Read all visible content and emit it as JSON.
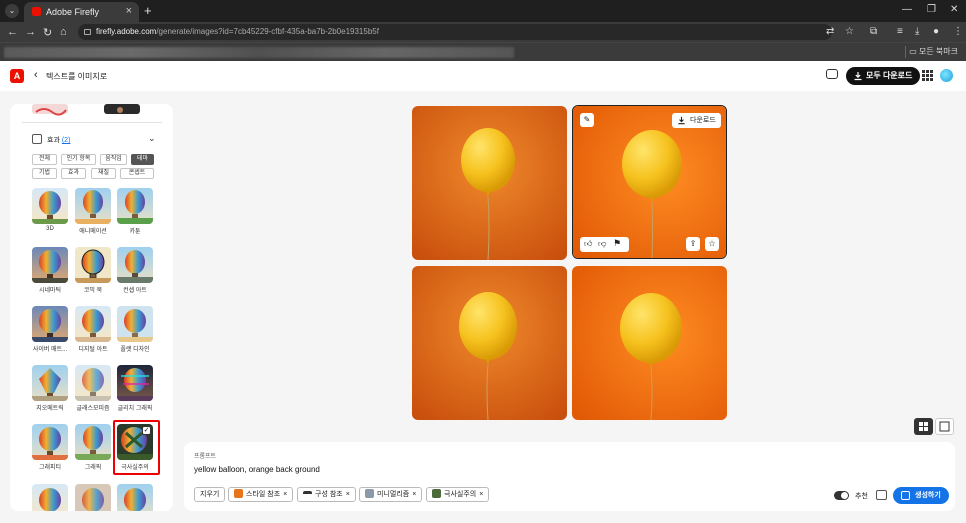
{
  "browser": {
    "tab_title": "Adobe Firefly",
    "url_host": "firefly.adobe.com",
    "url_path": "/generate/images?id=7cb45229-cfbf-435a-ba7b-2b0e19315b5f",
    "bookmarks_all": "모든 북마크"
  },
  "app": {
    "logo_text": "A",
    "breadcrumb": "텍스트를 이미지로",
    "download_all_label": "모두 다운로드"
  },
  "sidebar": {
    "effects_title": "효과",
    "effects_count": "(2)",
    "chips": [
      "전체",
      "인기 항목",
      "움직임",
      "테마",
      "기법",
      "효과",
      "재질",
      "콘셉트"
    ],
    "selected_chip": "테마",
    "tiles": [
      {
        "label": "3D"
      },
      {
        "label": "애니메이션"
      },
      {
        "label": "카툰"
      },
      {
        "label": "시네마틱"
      },
      {
        "label": "코믹 북"
      },
      {
        "label": "컨셉 아트"
      },
      {
        "label": "사이버 매트..."
      },
      {
        "label": "디지털 아트"
      },
      {
        "label": "플랫 디자인"
      },
      {
        "label": "지오메트릭"
      },
      {
        "label": "글래스모피즘"
      },
      {
        "label": "글리치 그래픽"
      },
      {
        "label": "그래피티"
      },
      {
        "label": "그래픽"
      },
      {
        "label": "극사실주의"
      }
    ],
    "selected_tile": "극사실주의"
  },
  "results": {
    "download_label": "다운로드"
  },
  "prompt": {
    "label": "프롬프트",
    "text": "yellow balloon, orange back ground",
    "clear_label": "지우기",
    "tags": [
      {
        "label": "스타일 참조",
        "color": "#e8741a"
      },
      {
        "label": "구성 참조",
        "color": "#333333"
      },
      {
        "label": "미니멀리즘",
        "color": "#8a9aa8"
      },
      {
        "label": "극사실주의",
        "color": "#4a6a3a"
      }
    ],
    "recommend_label": "추천",
    "generate_label": "생성하기"
  },
  "colors": {
    "accent": "#1473e6",
    "brand": "#eb1000",
    "highlight": "#e00000"
  }
}
